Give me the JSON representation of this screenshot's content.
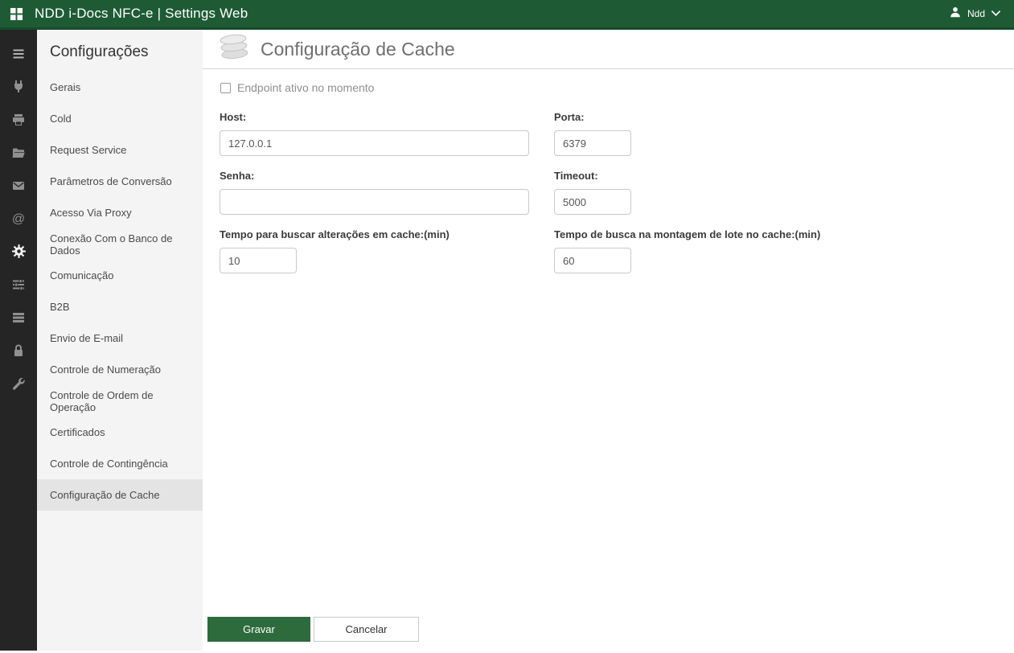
{
  "topbar": {
    "title": "NDD i-Docs NFC-e | Settings Web",
    "user_name": "Ndd"
  },
  "iconbar": {
    "icons": [
      "menu",
      "plug",
      "printer",
      "folder-open",
      "envelope",
      "at-sign",
      "gear",
      "sliders",
      "stack",
      "lock",
      "wrench"
    ],
    "active_icon": "gear"
  },
  "sidebar": {
    "title": "Configurações",
    "items": [
      {
        "label": "Gerais"
      },
      {
        "label": "Cold"
      },
      {
        "label": "Request Service"
      },
      {
        "label": "Parâmetros de Conversão"
      },
      {
        "label": "Acesso Via Proxy"
      },
      {
        "label": "Conexão Com o Banco de Dados"
      },
      {
        "label": "Comunicação"
      },
      {
        "label": "B2B"
      },
      {
        "label": "Envio de E-mail"
      },
      {
        "label": "Controle de Numeração"
      },
      {
        "label": "Controle de Ordem de Operação"
      },
      {
        "label": "Certificados"
      },
      {
        "label": "Controle de Contingência"
      },
      {
        "label": "Configuração de Cache",
        "active": true
      }
    ]
  },
  "main": {
    "title": "Configuração de Cache",
    "endpoint_checkbox_label": "Endpoint ativo no momento",
    "endpoint_checked": false,
    "fields": {
      "host": {
        "label": "Host:",
        "value": "127.0.0.1"
      },
      "porta": {
        "label": "Porta:",
        "value": "6379"
      },
      "senha": {
        "label": "Senha:",
        "value": ""
      },
      "timeout": {
        "label": "Timeout:",
        "value": "5000"
      },
      "tempo_busca_alteracoes": {
        "label": "Tempo para buscar alterações em cache:(min)",
        "value": "10"
      },
      "tempo_busca_lote": {
        "label": "Tempo de busca na montagem de lote no cache:(min)",
        "value": "60"
      }
    },
    "buttons": {
      "save": "Gravar",
      "cancel": "Cancelar"
    }
  },
  "colors": {
    "topbar_green": "#1e5b35",
    "save_button_green": "#2e6b3c",
    "iconbar_dark": "#252526",
    "sidebar_bg": "#f4f4f4"
  }
}
